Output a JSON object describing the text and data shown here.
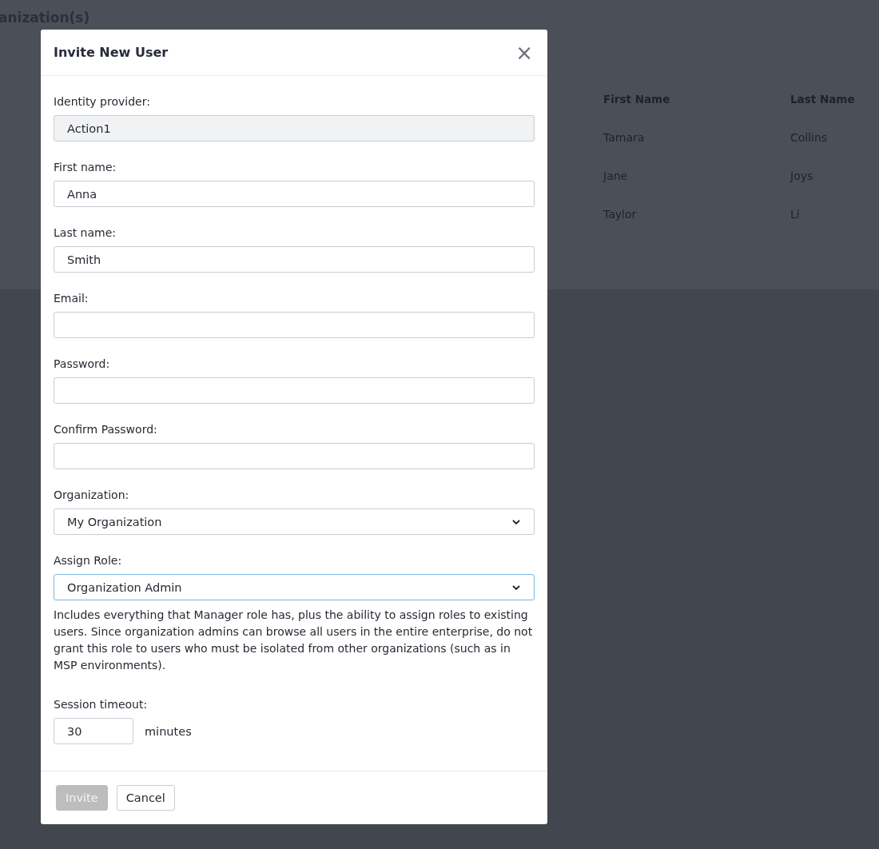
{
  "page": {
    "title": "anization(s)",
    "table": {
      "columns": [
        "First Name",
        "Last Name"
      ],
      "rows": [
        [
          "Tamara",
          "Collins"
        ],
        [
          "Jane",
          "Joys"
        ],
        [
          "Taylor",
          "Li"
        ]
      ]
    }
  },
  "dialog": {
    "title": "Invite New User",
    "close_icon": "×",
    "fields": [
      {
        "kind": "text",
        "label": "Identity provider:",
        "value": "Action1",
        "disabled": true,
        "focused": false
      },
      {
        "kind": "text",
        "label": "First name:",
        "value": "Anna",
        "disabled": false,
        "focused": false
      },
      {
        "kind": "text",
        "label": "Last name:",
        "value": "Smith",
        "disabled": false,
        "focused": false
      },
      {
        "kind": "text",
        "label": "Email:",
        "disabled": false,
        "focused": false
      },
      {
        "kind": "password",
        "label": "Password:",
        "disabled": false,
        "focused": false
      },
      {
        "kind": "password",
        "label": "Confirm Password:",
        "disabled": false,
        "focused": false
      },
      {
        "kind": "select",
        "label": "Organization:",
        "value": "My Organization",
        "disabled": false,
        "focused": false
      },
      {
        "kind": "select",
        "label": "Assign Role:",
        "value": "Organization Admin",
        "disabled": false,
        "focused": true
      }
    ],
    "role_description": "Includes everything that Manager role has, plus the ability to assign roles to existing users. Since organization admins can browse all users in the entire enterprise, do not grant this role to users who must be isolated from other organizations (such as in MSP environments).",
    "session_timeout": {
      "label": "Session timeout:",
      "value": "30",
      "unit": "minutes"
    },
    "buttons": [
      {
        "label": "Invite",
        "disabled": true
      },
      {
        "label": "Cancel",
        "disabled": false
      }
    ]
  }
}
